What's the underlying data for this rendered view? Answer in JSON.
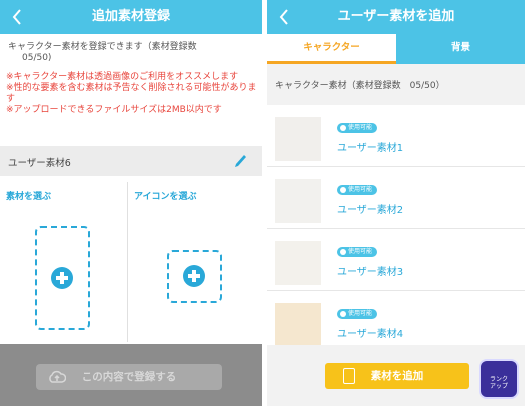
{
  "left": {
    "title": "追加素材登録",
    "notice": [
      "キャラクター素材を登録できます（素材登録数",
      "05/50)"
    ],
    "warnings": [
      "※キャラクター素材は透過画像のご利用をオススメします",
      "※性的な要素を含む素材は予告なく削除される可能性があります",
      "※アップロードできるファイルサイズは2MB以内です"
    ],
    "material_name": "ユーザー素材6",
    "choose_material_label": "素材を選ぶ",
    "choose_icon_label": "アイコンを選ぶ",
    "register_button": "この内容で登録する"
  },
  "right": {
    "title": "ユーザー素材を追加",
    "tabs": [
      "キャラクター",
      "背景"
    ],
    "section_label": "キャラクター素材（素材登録数　05/50）",
    "items": [
      {
        "badge": "使用可能",
        "name": "ユーザー素材1",
        "thumb_color": "#f1efec"
      },
      {
        "badge": "使用可能",
        "name": "ユーザー素材2",
        "thumb_color": "#f2f1ee"
      },
      {
        "badge": "使用可能",
        "name": "ユーザー素材3",
        "thumb_color": "#f3f1ec"
      },
      {
        "badge": "使用可能",
        "name": "ユーザー素材4",
        "thumb_color": "#f5e7cf"
      }
    ],
    "add_button": "素材を追加",
    "corner_badge": "ランク\nアップ"
  },
  "colors": {
    "header": "#4cc3e6",
    "accent_blue": "#29a8d8",
    "tab_active": "#f5a623",
    "warning": "#e8453c",
    "add_button": "#f7c21a"
  }
}
